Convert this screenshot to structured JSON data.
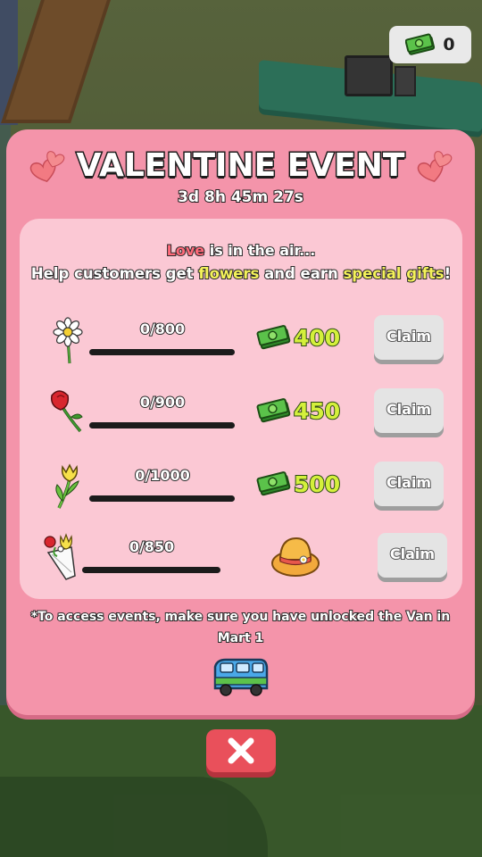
{
  "currency": {
    "amount": "0",
    "icon": "cash-icon"
  },
  "event": {
    "title": "VALENTINE EVENT",
    "timer": "3d 8h 45m 27s",
    "tagline_love": "Love",
    "tagline_rest": " is in the air...",
    "tagline2_a": "Help customers get ",
    "tagline2_flowers": "flowers",
    "tagline2_b": " and earn ",
    "tagline2_gifts": "special gifts",
    "tagline2_c": "!"
  },
  "rewards": [
    {
      "flower": "daisy-icon",
      "progress": "0/800",
      "fraction": 0,
      "reward_type": "cash",
      "reward": "400",
      "button": "Claim"
    },
    {
      "flower": "rose-icon",
      "progress": "0/900",
      "fraction": 0,
      "reward_type": "cash",
      "reward": "450",
      "button": "Claim"
    },
    {
      "flower": "tulip-icon",
      "progress": "0/1000",
      "fraction": 0,
      "reward_type": "cash",
      "reward": "500",
      "button": "Claim"
    },
    {
      "flower": "bouquet-icon",
      "progress": "0/850",
      "fraction": 0,
      "reward_type": "hat",
      "reward_icon": "straw-hat-icon",
      "button": "Claim"
    }
  ],
  "note": {
    "line1": "*To access events, make sure you have unlocked the Van in",
    "line2": "Mart 1"
  },
  "colors": {
    "panel": "#f494aa",
    "inner": "#fbc8d4",
    "close": "#e9505b",
    "reward_text": "#d4f03b"
  }
}
